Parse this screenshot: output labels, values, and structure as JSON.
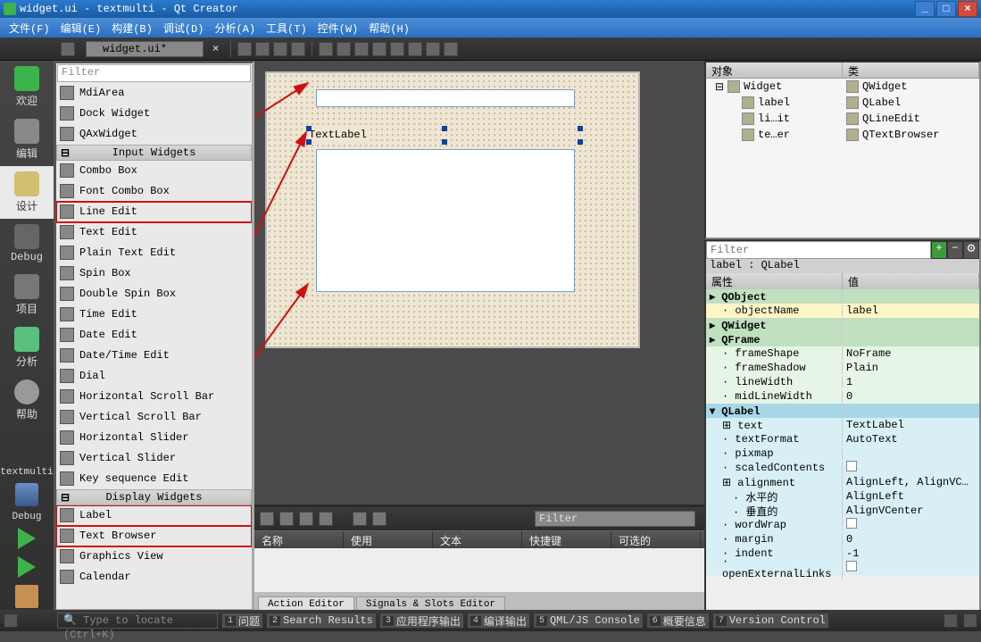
{
  "title": "widget.ui - textmulti - Qt Creator",
  "menu": [
    "文件(F)",
    "编辑(E)",
    "构建(B)",
    "调试(D)",
    "分析(A)",
    "工具(T)",
    "控件(W)",
    "帮助(H)"
  ],
  "docname": "widget.ui*",
  "modebar": {
    "welcome": "欢迎",
    "edit": "编辑",
    "design": "设计",
    "debug": "Debug",
    "proj": "项目",
    "anal": "分析",
    "help": "帮助",
    "project": "textmulti",
    "kit": "Debug"
  },
  "widgetbox": {
    "filter_placeholder": "Filter",
    "groups": {
      "input": "Input Widgets",
      "display": "Display Widgets"
    },
    "items_pre": [
      "MdiArea",
      "Dock Widget",
      "QAxWidget"
    ],
    "items_input": [
      "Combo Box",
      "Font Combo Box",
      "Line Edit",
      "Text Edit",
      "Plain Text Edit",
      "Spin Box",
      "Double Spin Box",
      "Time Edit",
      "Date Edit",
      "Date/Time Edit",
      "Dial",
      "Horizontal Scroll Bar",
      "Vertical Scroll Bar",
      "Horizontal Slider",
      "Vertical Slider",
      "Key sequence Edit"
    ],
    "items_display": [
      "Label",
      "Text Browser",
      "Graphics View",
      "Calendar"
    ]
  },
  "canvas": {
    "textlabel": "TextLabel"
  },
  "actionpanel": {
    "filter_placeholder": "Filter",
    "headers": [
      "名称",
      "使用",
      "文本",
      "快捷键",
      "可选的"
    ],
    "tabs": [
      "Action Editor",
      "Signals & Slots Editor"
    ]
  },
  "objinspector": {
    "cols": [
      "对象",
      "类"
    ],
    "rows": [
      {
        "obj": "Widget",
        "cls": "QWidget",
        "root": true
      },
      {
        "obj": "label",
        "cls": "QLabel"
      },
      {
        "obj": "li…it",
        "cls": "QLineEdit"
      },
      {
        "obj": "te…er",
        "cls": "QTextBrowser"
      }
    ]
  },
  "prop": {
    "filter_placeholder": "Filter",
    "objline": "label : QLabel",
    "cols": [
      "属性",
      "值"
    ],
    "groups": [
      {
        "name": "QObject",
        "style": "ghdr",
        "rows": [
          {
            "k": "objectName",
            "v": "label",
            "style": "yel"
          }
        ]
      },
      {
        "name": "QWidget",
        "style": "ghdr",
        "rows": []
      },
      {
        "name": "QFrame",
        "style": "ghdr",
        "rows": [
          {
            "k": "frameShape",
            "v": "NoFrame",
            "style": "prop-g"
          },
          {
            "k": "frameShadow",
            "v": "Plain",
            "style": "prop-g"
          },
          {
            "k": "lineWidth",
            "v": "1",
            "style": "prop-g"
          },
          {
            "k": "midLineWidth",
            "v": "0",
            "style": "prop-g"
          }
        ]
      },
      {
        "name": "QLabel",
        "style": "chdr",
        "rows": [
          {
            "k": "text",
            "v": "TextLabel",
            "style": "prop-c",
            "expand": true
          },
          {
            "k": "textFormat",
            "v": "AutoText",
            "style": "prop-c"
          },
          {
            "k": "pixmap",
            "v": "",
            "style": "prop-c"
          },
          {
            "k": "scaledContents",
            "v": "",
            "style": "prop-c",
            "cb": true
          },
          {
            "k": "alignment",
            "v": "AlignLeft, AlignVC…",
            "style": "prop-c",
            "expand": true
          },
          {
            "k": "水平的",
            "v": "AlignLeft",
            "style": "prop-c",
            "ind": true
          },
          {
            "k": "垂直的",
            "v": "AlignVCenter",
            "style": "prop-c",
            "ind": true
          },
          {
            "k": "wordWrap",
            "v": "",
            "style": "prop-c",
            "cb": true
          },
          {
            "k": "margin",
            "v": "0",
            "style": "prop-c"
          },
          {
            "k": "indent",
            "v": "-1",
            "style": "prop-c"
          },
          {
            "k": "openExternalLinks",
            "v": "",
            "style": "prop-c",
            "cb": true
          }
        ]
      }
    ]
  },
  "statusbar": {
    "locate": "Type to locate (Ctrl+K)",
    "tabs": [
      "问题",
      "Search Results",
      "应用程序输出",
      "编译输出",
      "QML/JS Console",
      "概要信息",
      "Version Control"
    ]
  }
}
